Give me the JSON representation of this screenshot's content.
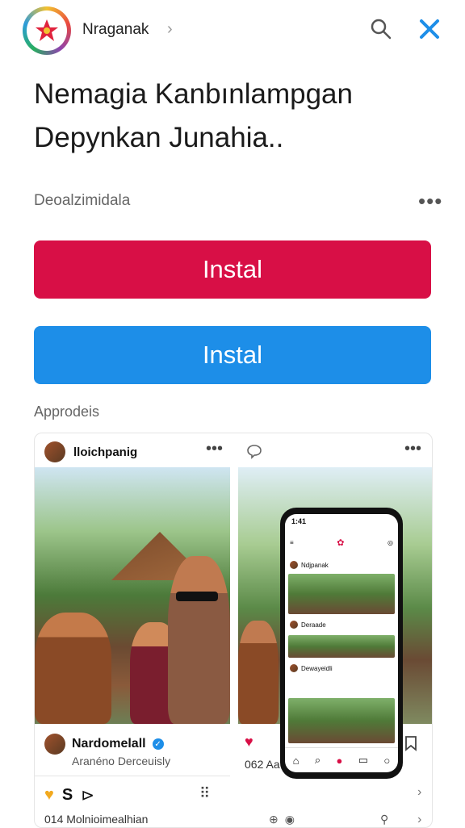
{
  "header": {
    "brand": "Nraganak",
    "chevron": "›",
    "icons": [
      "search-icon",
      "close-x-icon"
    ],
    "accent": "#1d8ee8"
  },
  "title": {
    "line1": "Nemagia Kanbınlampgan",
    "line2": "Depynkan Junahia.."
  },
  "section": {
    "label": "Deoalzimidala",
    "more": "•••"
  },
  "buttons": {
    "primary": {
      "label": "Instal",
      "color": "#d80f46"
    },
    "secondary": {
      "label": "Instal",
      "color": "#1d8ee8"
    }
  },
  "apps_label": "Approdeis",
  "post": {
    "user": "lloichpanig",
    "more": "•••",
    "footer_name": "Nardomelall",
    "footer_sub": "Aranéno  Derceuisly",
    "count_left": "014  Molnioimealhian",
    "count_right": "062  Aa",
    "phone": {
      "status": "1:41",
      "header_user": "Ndjpanak",
      "row2": "Deraade",
      "row3": "Dewayeidli"
    }
  }
}
